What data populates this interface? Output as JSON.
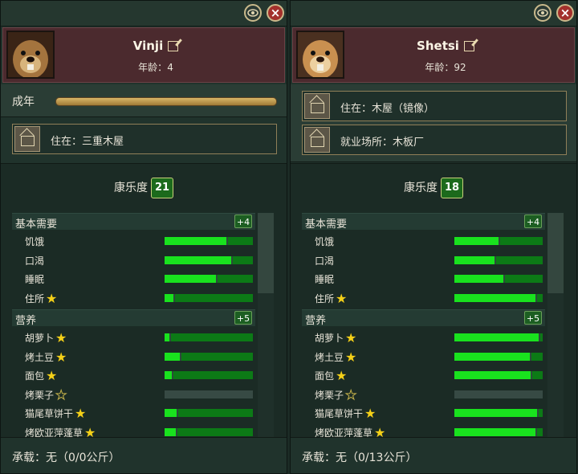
{
  "panels": [
    {
      "name": "Vinji",
      "age_label": "年龄：",
      "age_value": "4",
      "stage_label": "成年",
      "lives_in": "住在：三重木屋",
      "wellbeing_label": "康乐度",
      "wellbeing_value": "21",
      "sections": [
        {
          "title": "基本需要",
          "bonus": "+4",
          "needs": [
            {
              "label": "饥饿",
              "fill": 0.7,
              "star": "none"
            },
            {
              "label": "口渴",
              "fill": 0.75,
              "star": "none"
            },
            {
              "label": "睡眠",
              "fill": 0.58,
              "star": "none"
            },
            {
              "label": "住所",
              "fill": 0.1,
              "star": "full"
            }
          ]
        },
        {
          "title": "营养",
          "bonus": "+5",
          "needs": [
            {
              "label": "胡萝卜",
              "fill": 0.05,
              "star": "full"
            },
            {
              "label": "烤土豆",
              "fill": 0.17,
              "star": "full"
            },
            {
              "label": "面包",
              "fill": 0.08,
              "star": "full"
            },
            {
              "label": "烤栗子",
              "fill": 0.0,
              "star": "empty",
              "dead": true
            },
            {
              "label": "猫尾草饼干",
              "fill": 0.14,
              "star": "full"
            },
            {
              "label": "烤欧亚萍蓬草",
              "fill": 0.13,
              "star": "full"
            }
          ]
        }
      ],
      "carry": "承载：无（0/0公斤）"
    },
    {
      "name": "Shetsi",
      "age_label": "年龄：",
      "age_value": "92",
      "lives_in": "住在：木屋（镜像）",
      "workplace": "就业场所：木板厂",
      "wellbeing_label": "康乐度",
      "wellbeing_value": "18",
      "sections": [
        {
          "title": "基本需要",
          "bonus": "+4",
          "needs": [
            {
              "label": "饥饿",
              "fill": 0.5,
              "star": "none"
            },
            {
              "label": "口渴",
              "fill": 0.45,
              "star": "none"
            },
            {
              "label": "睡眠",
              "fill": 0.55,
              "star": "none"
            },
            {
              "label": "住所",
              "fill": 0.92,
              "star": "full"
            }
          ]
        },
        {
          "title": "营养",
          "bonus": "+5",
          "needs": [
            {
              "label": "胡萝卜",
              "fill": 0.95,
              "star": "full"
            },
            {
              "label": "烤土豆",
              "fill": 0.85,
              "star": "full"
            },
            {
              "label": "面包",
              "fill": 0.86,
              "star": "full"
            },
            {
              "label": "烤栗子",
              "fill": 0.0,
              "star": "empty",
              "dead": true
            },
            {
              "label": "猫尾草饼干",
              "fill": 0.94,
              "star": "full"
            },
            {
              "label": "烤欧亚萍蓬草",
              "fill": 0.92,
              "star": "full"
            }
          ]
        }
      ],
      "carry": "承载：无（0/13公斤）"
    }
  ],
  "colors": {
    "bar_fill": "#19e21e",
    "bar_rest": "#0c7a16",
    "header": "#4b2a2e",
    "star": "#f4d018"
  },
  "icons": {
    "view": "eye-icon",
    "close": "close-icon",
    "edit": "edit-icon",
    "home": "house-icon",
    "work": "workplace-icon"
  }
}
